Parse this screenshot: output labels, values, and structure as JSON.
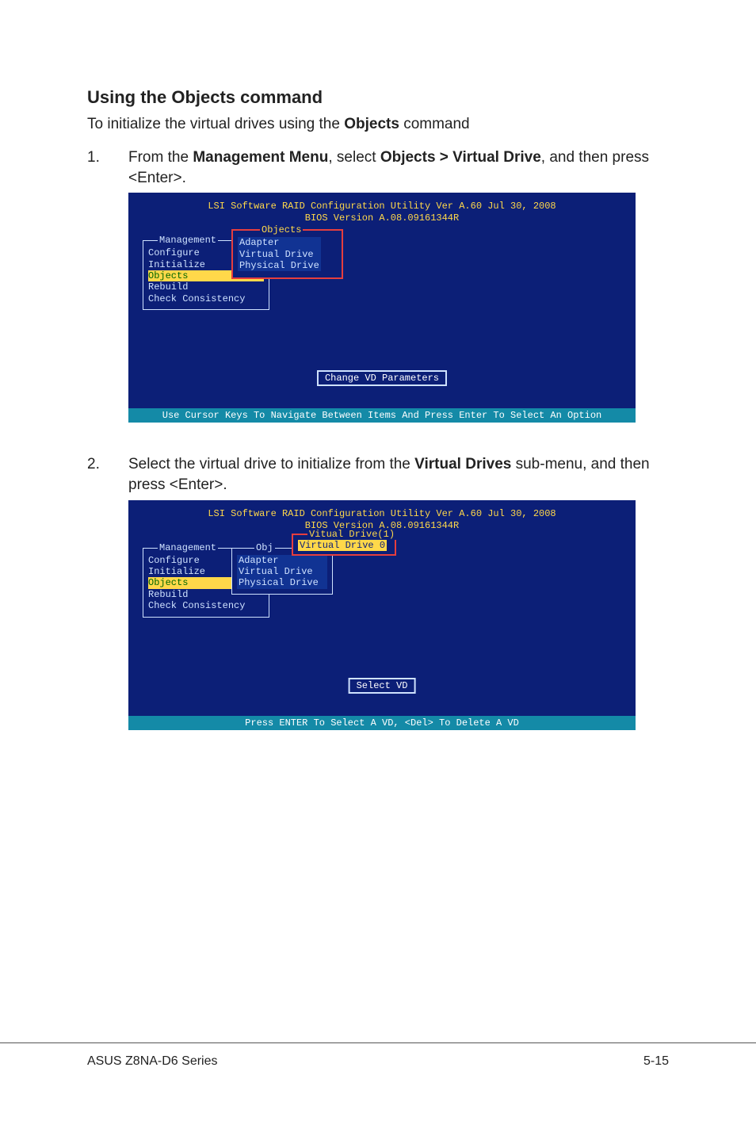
{
  "section_title": "Using the Objects command",
  "intro_pre": "To initialize the virtual drives using the ",
  "intro_bold": "Objects",
  "intro_post": " command",
  "steps": {
    "s1": {
      "num": "1.",
      "pre": "From the ",
      "b1": "Management Menu",
      "mid": ", select ",
      "b2": "Objects > Virtual Drive",
      "post": ", and then press <Enter>."
    },
    "s2": {
      "num": "2.",
      "pre": "Select the virtual drive to initialize from the ",
      "b1": "Virtual Drives",
      "post": " sub-menu, and then press <Enter>."
    }
  },
  "bios1": {
    "header1": "LSI Software RAID Configuration Utility Ver A.60 Jul 30, 2008",
    "header2": "BIOS Version   A.08.09161344R",
    "mgmt_title": "Management",
    "mgmt_items": [
      "Configure",
      "Initialize",
      "Objects",
      "Rebuild",
      "Check Consistency"
    ],
    "obj_title": "Objects",
    "obj_items": [
      "Adapter",
      "Virtual Drive",
      "Physical Drive"
    ],
    "instr": "Change VD Parameters",
    "footer": "Use Cursor Keys To Navigate Between Items And Press Enter To Select An Option"
  },
  "bios2": {
    "header1": "LSI Software RAID Configuration Utility Ver A.60 Jul 30, 2008",
    "header2": "BIOS Version   A.08.09161344R",
    "mgmt_title": "Management",
    "mgmt_items": [
      "Configure",
      "Initialize",
      "Objects",
      "Rebuild",
      "Check Consistency"
    ],
    "obj_title": "Obj",
    "obj_items": [
      "Adapter",
      "Virtual Drive",
      "Physical Drive"
    ],
    "vd_title": "Vitual Drive(1)",
    "vd_item": "Virtual Drive 0",
    "instr": "Select VD",
    "footer": "Press ENTER To Select A VD, <Del> To Delete A VD"
  },
  "page_footer": {
    "left": "ASUS Z8NA-D6 Series",
    "right": "5-15"
  }
}
